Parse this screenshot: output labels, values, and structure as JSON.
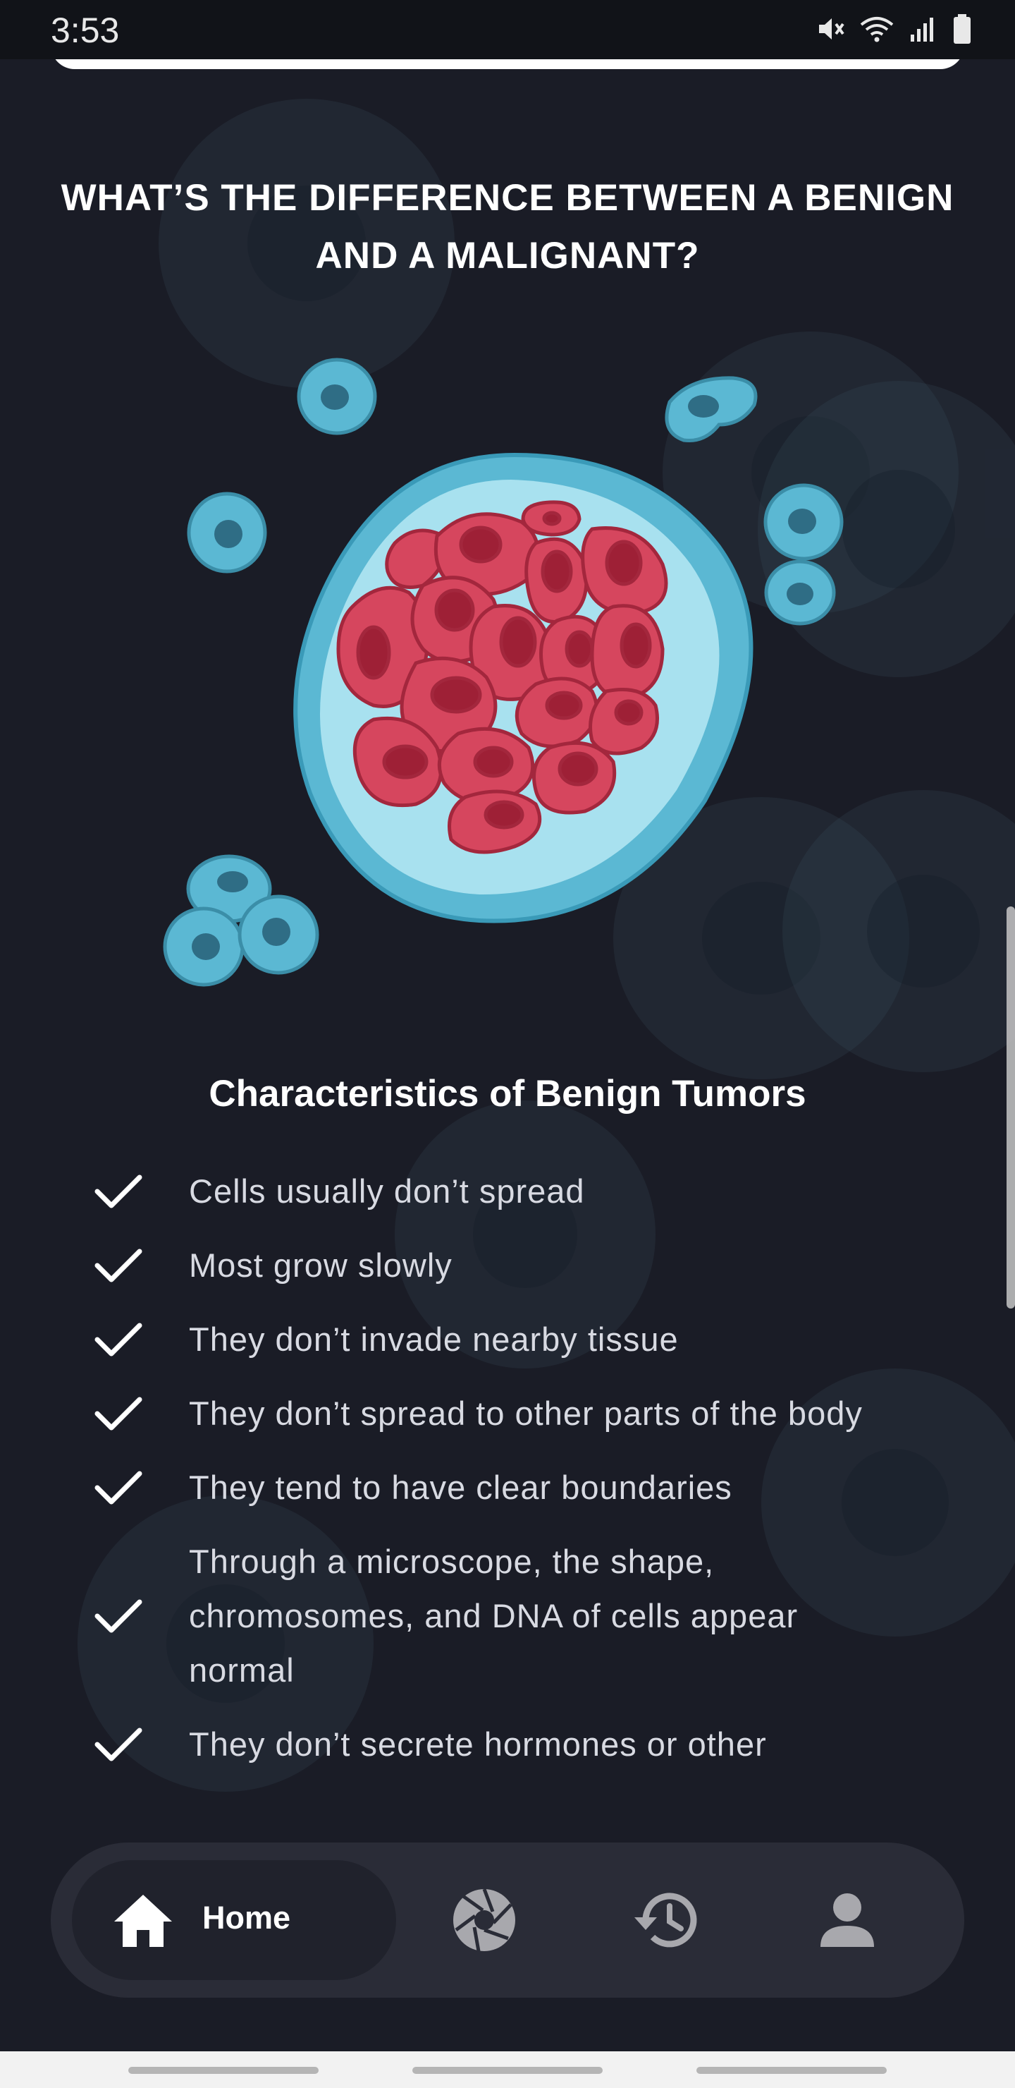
{
  "status_bar": {
    "time": "3:53",
    "icons": [
      "mute-icon",
      "wifi-icon",
      "signal-icon",
      "battery-icon"
    ]
  },
  "page": {
    "title": "WHAT’S THE DIFFERENCE BETWEEN A BENIGN AND A MALIGNANT?",
    "section_title": "Characteristics of Benign Tumors",
    "characteristics": [
      "Cells usually don’t spread",
      "Most grow slowly",
      "They don’t invade nearby tissue",
      "They don’t spread to other parts of the body",
      "They tend to have clear boundaries",
      "Through a microscope, the shape, chromosomes, and DNA of cells appear normal",
      "They don’t secrete hormones or other"
    ]
  },
  "bottom_nav": {
    "items": [
      {
        "icon": "home-icon",
        "label": "Home",
        "active": true
      },
      {
        "icon": "camera-aperture-icon",
        "label": "",
        "active": false
      },
      {
        "icon": "history-icon",
        "label": "",
        "active": false
      },
      {
        "icon": "profile-icon",
        "label": "",
        "active": false
      }
    ]
  },
  "colors": {
    "background": "#1a1c26",
    "nav_background": "#2a2c37",
    "cell_blue": "#5bb8d3",
    "tumor_red": "#d6465e"
  }
}
